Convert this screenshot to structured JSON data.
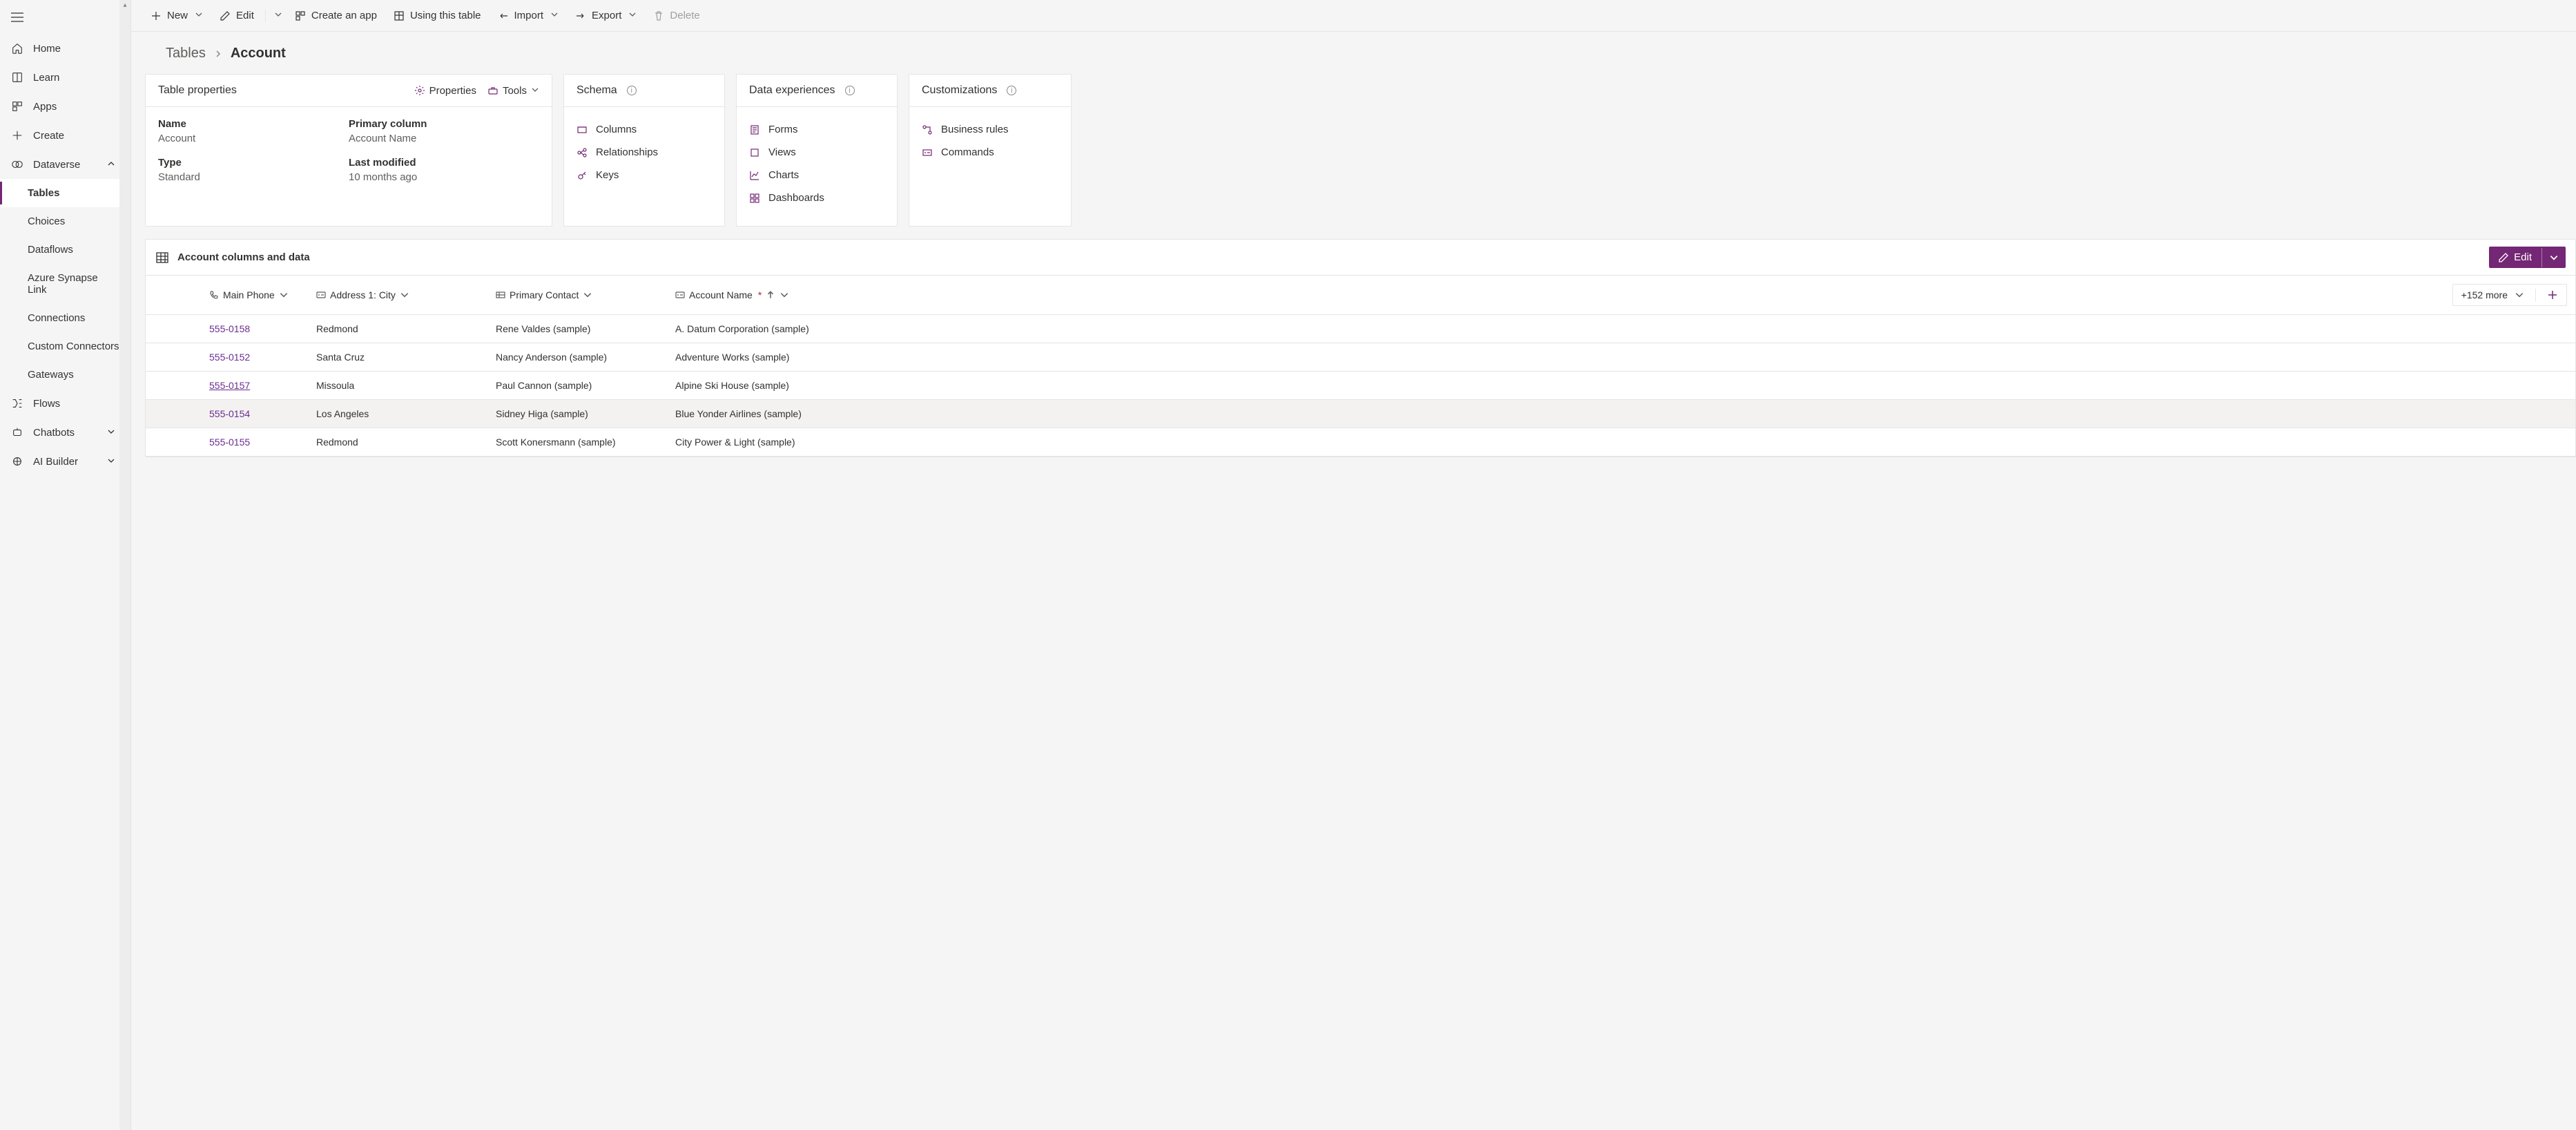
{
  "sidebar": {
    "items": [
      {
        "id": "home",
        "label": "Home"
      },
      {
        "id": "learn",
        "label": "Learn"
      },
      {
        "id": "apps",
        "label": "Apps"
      },
      {
        "id": "create",
        "label": "Create"
      },
      {
        "id": "dataverse",
        "label": "Dataverse",
        "expanded": true,
        "children": [
          {
            "id": "tables",
            "label": "Tables",
            "active": true
          },
          {
            "id": "choices",
            "label": "Choices"
          },
          {
            "id": "dataflows",
            "label": "Dataflows"
          },
          {
            "id": "synapse",
            "label": "Azure Synapse Link"
          },
          {
            "id": "connections",
            "label": "Connections"
          },
          {
            "id": "customconn",
            "label": "Custom Connectors"
          },
          {
            "id": "gateways",
            "label": "Gateways"
          }
        ]
      },
      {
        "id": "flows",
        "label": "Flows"
      },
      {
        "id": "chatbots",
        "label": "Chatbots",
        "expandable": true
      },
      {
        "id": "aibuilder",
        "label": "AI Builder",
        "expandable": true
      }
    ]
  },
  "toolbar": {
    "new": "New",
    "edit": "Edit",
    "createapp": "Create an app",
    "usingtable": "Using this table",
    "import": "Import",
    "export": "Export",
    "delete": "Delete"
  },
  "breadcrumb": {
    "root": "Tables",
    "current": "Account"
  },
  "cards": {
    "properties": {
      "title": "Table properties",
      "actions": {
        "properties": "Properties",
        "tools": "Tools"
      },
      "fields": {
        "name_label": "Name",
        "name_value": "Account",
        "type_label": "Type",
        "type_value": "Standard",
        "pc_label": "Primary column",
        "pc_value": "Account Name",
        "lm_label": "Last modified",
        "lm_value": "10 months ago"
      }
    },
    "schema": {
      "title": "Schema",
      "links": [
        "Columns",
        "Relationships",
        "Keys"
      ]
    },
    "experiences": {
      "title": "Data experiences",
      "links": [
        "Forms",
        "Views",
        "Charts",
        "Dashboards"
      ]
    },
    "custom": {
      "title": "Customizations",
      "links": [
        "Business rules",
        "Commands"
      ]
    }
  },
  "datagrid": {
    "header": "Account columns and data",
    "editbtn": "Edit",
    "more": "+152 more",
    "columns": {
      "phone": "Main Phone",
      "city": "Address 1: City",
      "contact": "Primary Contact",
      "name": "Account Name"
    },
    "rows": [
      {
        "phone": "555-0158",
        "city": "Redmond",
        "contact": "Rene Valdes (sample)",
        "name": "A. Datum Corporation (sample)"
      },
      {
        "phone": "555-0152",
        "city": "Santa Cruz",
        "contact": "Nancy Anderson (sample)",
        "name": "Adventure Works (sample)"
      },
      {
        "phone": "555-0157",
        "city": "Missoula",
        "contact": "Paul Cannon (sample)",
        "name": "Alpine Ski House (sample)",
        "phoneUnderline": true
      },
      {
        "phone": "555-0154",
        "city": "Los Angeles",
        "contact": "Sidney Higa (sample)",
        "name": "Blue Yonder Airlines (sample)",
        "hover": true
      },
      {
        "phone": "555-0155",
        "city": "Redmond",
        "contact": "Scott Konersmann (sample)",
        "name": "City Power & Light (sample)"
      }
    ]
  }
}
